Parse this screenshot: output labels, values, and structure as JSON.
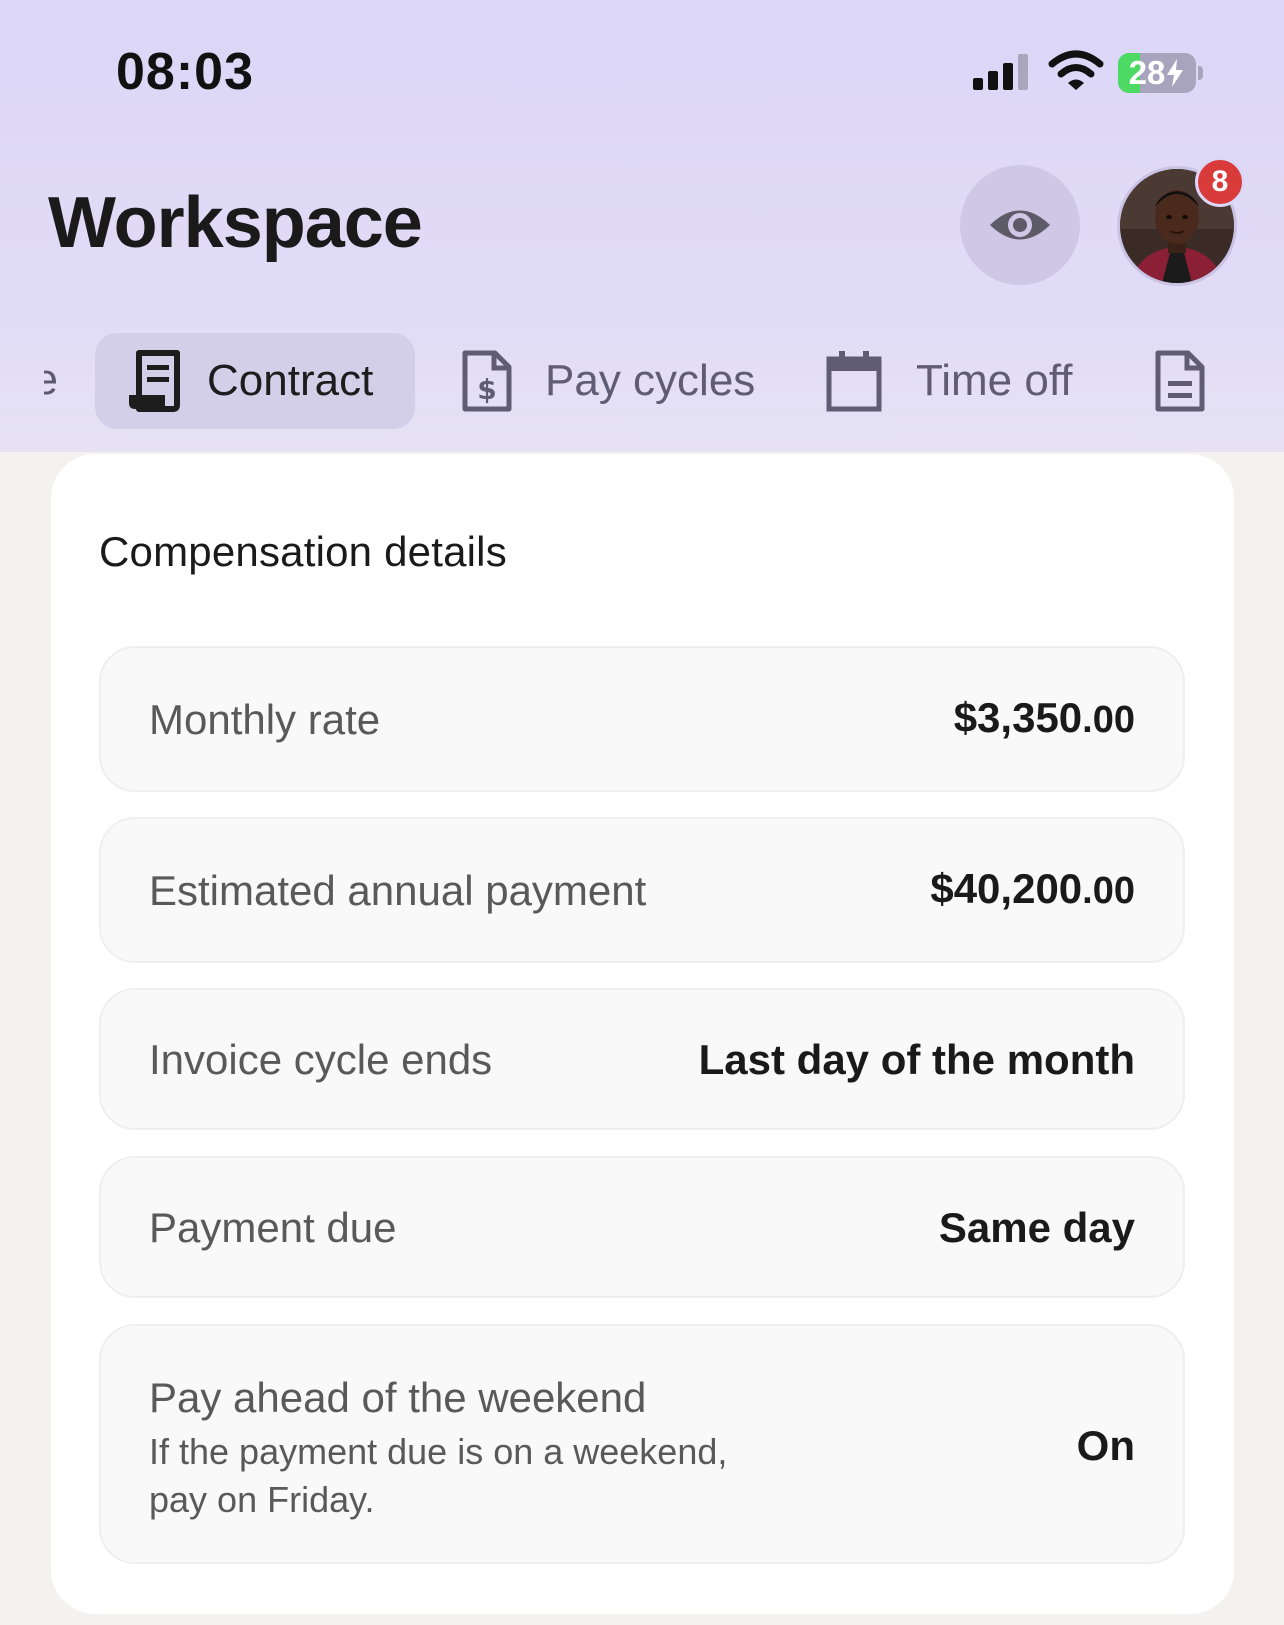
{
  "status_bar": {
    "time": "08:03",
    "battery_level": "28",
    "battery_fraction": 0.28,
    "icons": [
      "cellular-signal-icon",
      "wifi-icon",
      "battery-charging-icon"
    ]
  },
  "header": {
    "title": "Workspace",
    "notification_count": "8",
    "icons": [
      "eye-icon",
      "avatar"
    ]
  },
  "tabs": {
    "partial_label": "e",
    "items": [
      {
        "label": "Contract",
        "icon": "receipt-icon",
        "active": true
      },
      {
        "label": "Pay cycles",
        "icon": "dollar-document-icon",
        "active": false
      },
      {
        "label": "Time off",
        "icon": "calendar-icon",
        "active": false
      },
      {
        "label": "",
        "icon": "document-icon",
        "active": false
      }
    ]
  },
  "compensation": {
    "title": "Compensation details",
    "rows": [
      {
        "label": "Monthly rate",
        "value_main": "$3,350",
        "value_cents": ".00"
      },
      {
        "label": "Estimated annual payment",
        "value_main": "$40,200",
        "value_cents": ".00"
      },
      {
        "label": "Invoice cycle ends",
        "value_main": "Last day of the month"
      },
      {
        "label": "Payment due",
        "value_main": "Same day"
      },
      {
        "label": "Pay ahead of the weekend",
        "sublabel": "If the payment due is on a weekend, pay on Friday.",
        "value_main": "On"
      }
    ]
  },
  "colors": {
    "header_bg": "#dcd6f7",
    "active_tab_bg": "#d4cfe8",
    "badge": "#d93a3a",
    "battery_fill": "#4cd964"
  }
}
